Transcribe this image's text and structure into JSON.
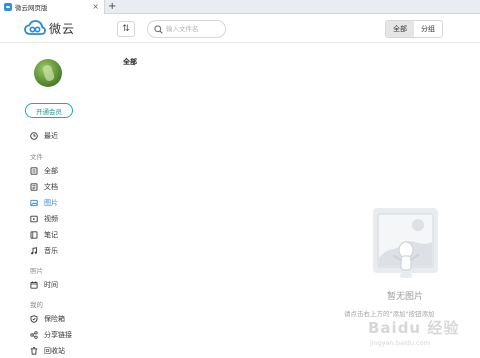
{
  "browser": {
    "tab_title": "微云网页版",
    "close_glyph": "×",
    "new_tab_glyph": "+"
  },
  "header": {
    "logo_text": "微云",
    "sort_glyph": "⇅",
    "search_placeholder": "输入文件名",
    "view_tabs": [
      {
        "label": "全部",
        "active": true
      },
      {
        "label": "分组",
        "active": false
      }
    ]
  },
  "sidebar": {
    "vip_button": "开通会员",
    "recent": {
      "label": "最近",
      "icon": "clock-icon"
    },
    "sections": [
      {
        "title": "文件",
        "items": [
          {
            "label": "全部",
            "icon": "all-files-icon"
          },
          {
            "label": "文档",
            "icon": "document-icon"
          },
          {
            "label": "图片",
            "icon": "image-icon",
            "active": true
          },
          {
            "label": "视频",
            "icon": "video-icon"
          },
          {
            "label": "笔记",
            "icon": "note-icon"
          },
          {
            "label": "音乐",
            "icon": "music-icon"
          }
        ]
      },
      {
        "title": "照片",
        "items": [
          {
            "label": "时间",
            "icon": "calendar-icon"
          }
        ]
      },
      {
        "title": "我的",
        "items": [
          {
            "label": "保险箱",
            "icon": "safe-icon"
          },
          {
            "label": "分享链接",
            "icon": "share-icon"
          },
          {
            "label": "回收站",
            "icon": "trash-icon"
          }
        ]
      }
    ]
  },
  "main": {
    "title": "全部",
    "empty_title": "暂无图片",
    "empty_hint": "请点击右上方的\"添加\"按钮添加"
  },
  "watermark": {
    "brand": "Baidu 经验",
    "url": "jingyan.baidu.com"
  },
  "colors": {
    "accent": "#2d7fd3",
    "vip": "#1bb09c"
  }
}
